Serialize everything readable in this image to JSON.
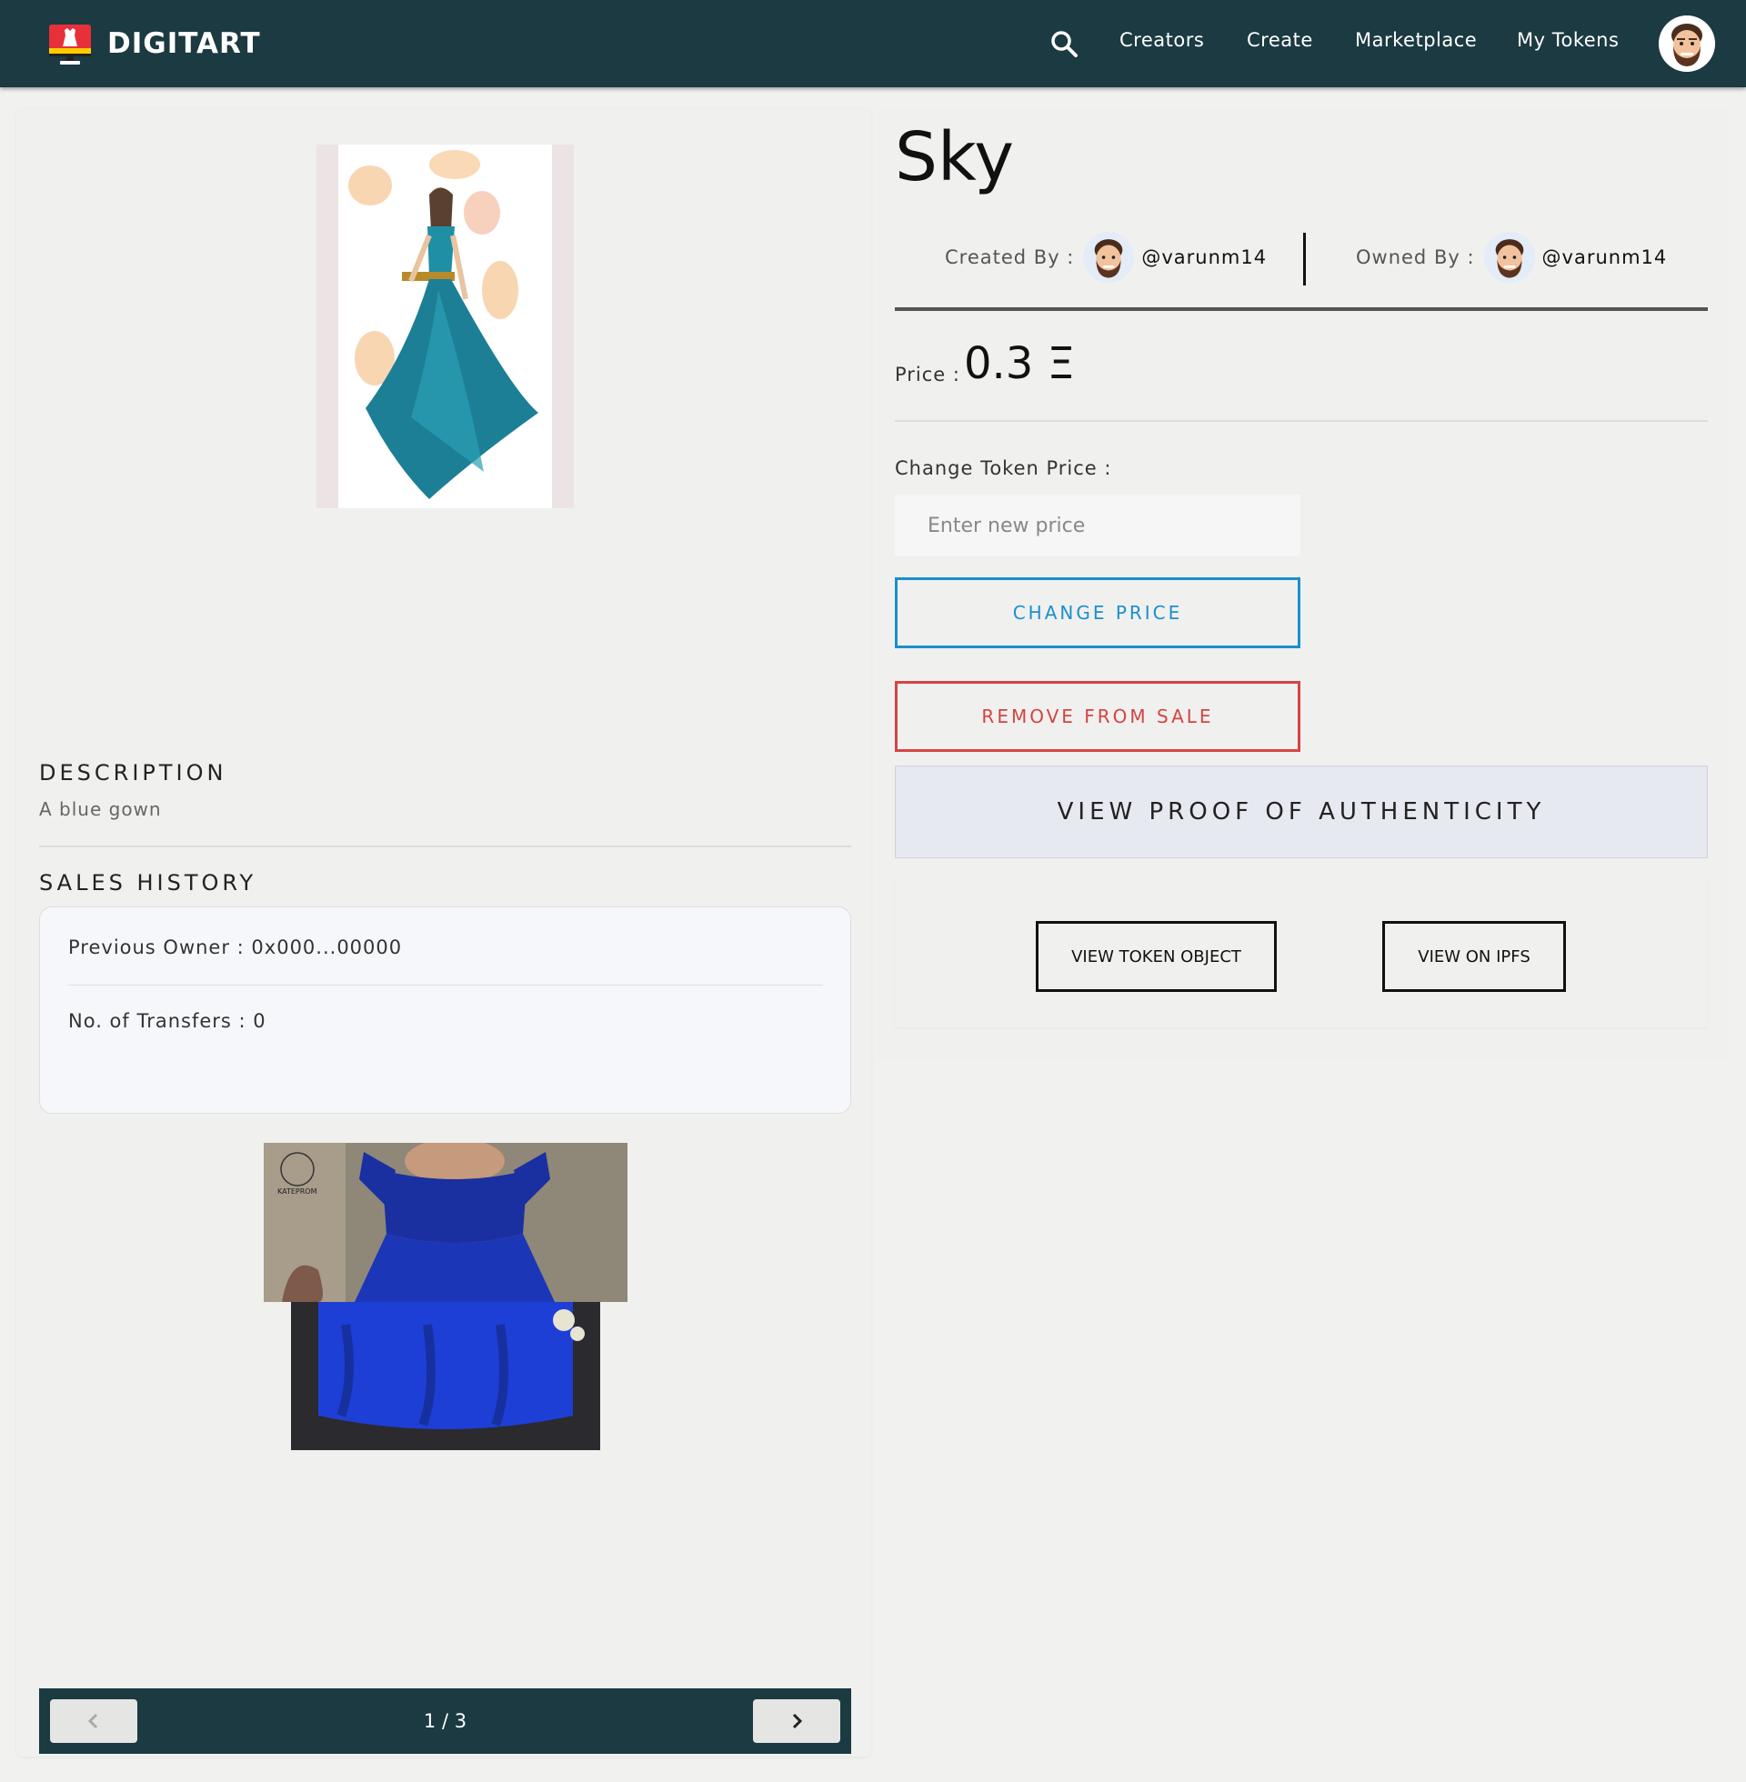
{
  "navbar": {
    "brand": "DIGITART",
    "links": [
      "Creators",
      "Create",
      "Marketplace",
      "My Tokens"
    ]
  },
  "token": {
    "title": "Sky",
    "created_by_label": "Created By :",
    "creator": "@varunm14",
    "owned_by_label": "Owned By :",
    "owner": "@varunm14",
    "price_label": "Price :",
    "price_value": "0.3 Ξ"
  },
  "change_price": {
    "label": "Change Token Price :",
    "placeholder": "Enter new price",
    "value": ""
  },
  "buttons": {
    "change_price": "CHANGE PRICE",
    "remove_from_sale": "REMOVE FROM SALE",
    "view_proof": "VIEW PROOF OF AUTHENTICITY",
    "view_token_object": "VIEW TOKEN OBJECT",
    "view_on_ipfs": "VIEW ON IPFS"
  },
  "description": {
    "title": "DESCRIPTION",
    "text": "A blue gown"
  },
  "sales_history": {
    "title": "SALES HISTORY",
    "previous_owner": "Previous Owner : 0x000...00000",
    "transfers": "No. of Transfers : 0"
  },
  "images": {
    "watermark": "KATEPROM"
  },
  "pager": {
    "label": "1 / 3"
  },
  "colors": {
    "navbar": "#1b3a42",
    "change_price_accent": "#1b8fcf",
    "remove_accent": "#d44444"
  },
  "icons": [
    "digitart-logo-icon",
    "search-icon",
    "avatar",
    "chevron-left-icon",
    "chevron-right-icon"
  ]
}
